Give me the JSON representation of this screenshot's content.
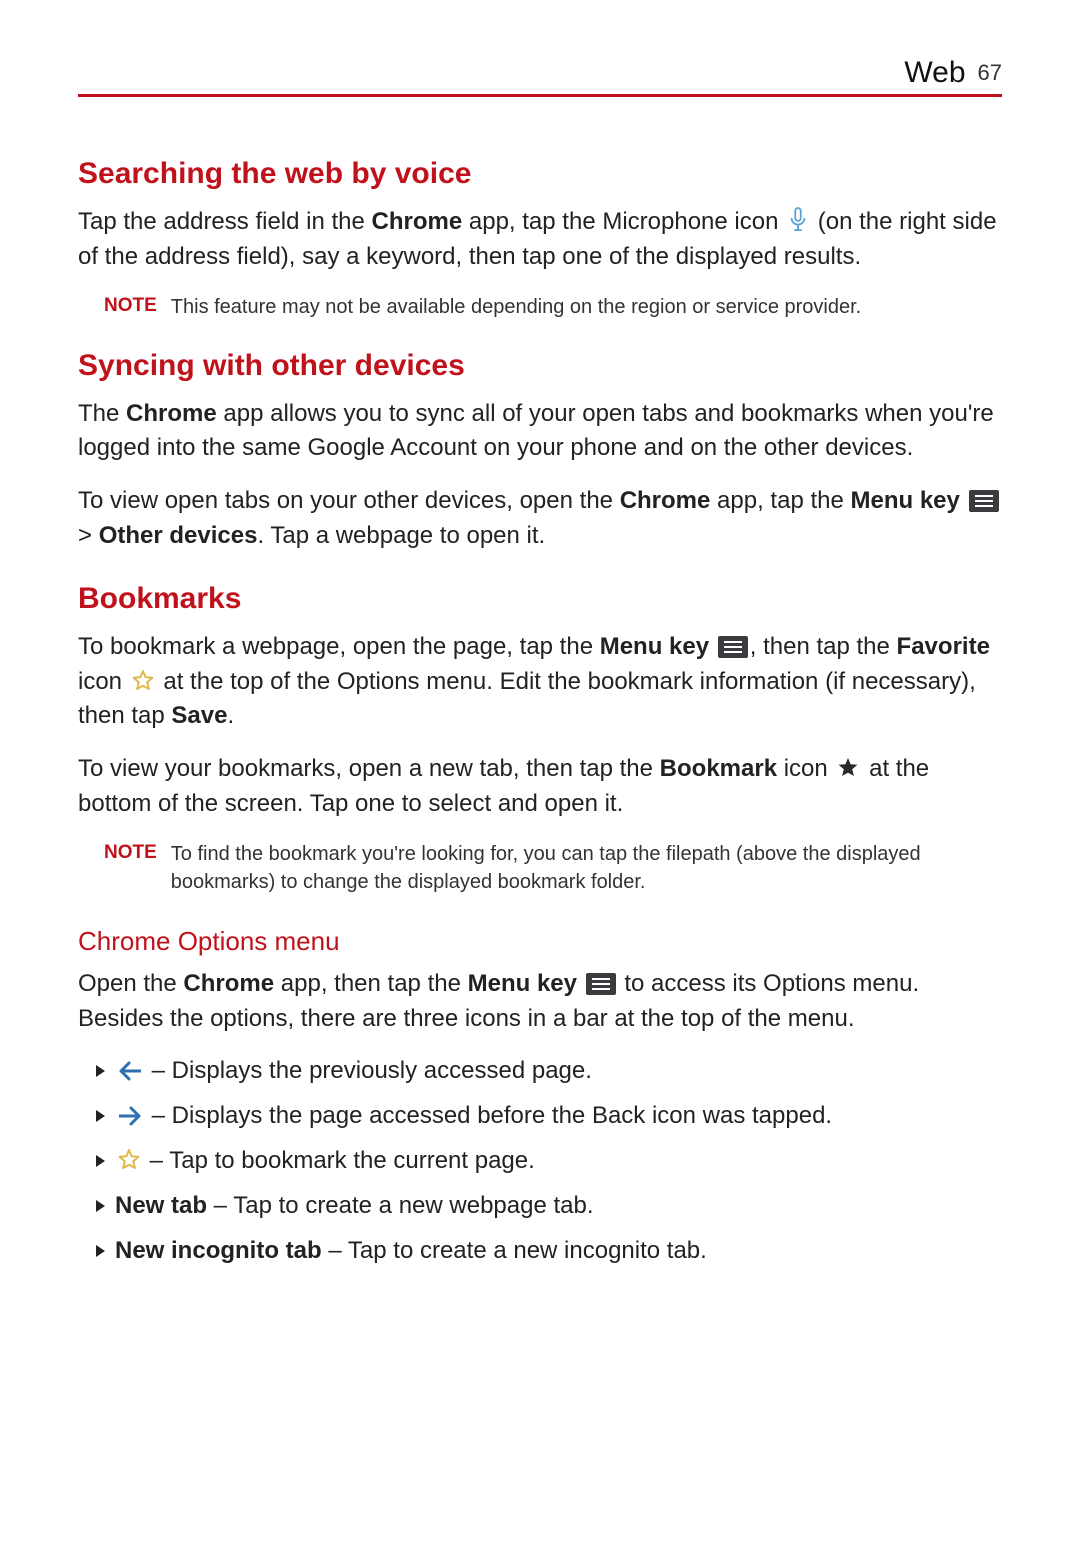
{
  "header": {
    "section": "Web",
    "page_number": "67"
  },
  "s1": {
    "title": "Searching the web by voice",
    "p1a": "Tap the address field in the ",
    "p1_chrome": "Chrome",
    "p1b": " app, tap the Microphone icon ",
    "p1c": " (on the right side of the address field), say a keyword, then tap one of the displayed results.",
    "note_label": "NOTE",
    "note": "This feature may not be available depending on the region or service provider."
  },
  "s2": {
    "title": "Syncing with other devices",
    "p1a": "The ",
    "p1_chrome": "Chrome",
    "p1b": " app allows you to sync all of your open tabs and bookmarks when you're logged into the same Google Account on your phone and on the other devices.",
    "p2a": "To view open tabs on your other devices, open the ",
    "p2_chrome": "Chrome",
    "p2b": " app, tap the ",
    "p2_menukey": "Menu key",
    "p2c": " > ",
    "p2_other": "Other devices",
    "p2d": ". Tap a webpage to open it."
  },
  "s3": {
    "title": "Bookmarks",
    "p1a": "To bookmark a webpage, open the page, tap the ",
    "p1_menukey": "Menu key",
    "p1b": ", then tap the ",
    "p1_fav": "Favorite",
    "p1c": " icon ",
    "p1d": " at the top of the Options menu. Edit the bookmark information (if necessary), then tap ",
    "p1_save": "Save",
    "p1e": ".",
    "p2a": "To view your bookmarks, open a new tab, then tap the ",
    "p2_bm": "Bookmark",
    "p2b": " icon ",
    "p2c": " at the bottom of the screen. Tap one to select and open it.",
    "note_label": "NOTE",
    "note": "To find the bookmark you're looking for, you can tap the filepath (above the displayed bookmarks) to change the displayed bookmark folder."
  },
  "s4": {
    "title": "Chrome Options menu",
    "p1a": "Open the ",
    "p1_chrome": "Chrome",
    "p1b": " app, then tap the ",
    "p1_menukey": "Menu key",
    "p1c": " to access its Options menu. Besides the options, there are three icons in a bar at the top of the menu.",
    "items": [
      {
        "kind": "icon",
        "icon": "back",
        "text": " – Displays the previously accessed page."
      },
      {
        "kind": "icon",
        "icon": "fwd",
        "text": " – Displays the page accessed before the Back icon was tapped."
      },
      {
        "kind": "icon",
        "icon": "star",
        "text": " – Tap to bookmark the current page."
      },
      {
        "kind": "bold",
        "label": "New tab",
        "text": " – Tap to create a new webpage tab."
      },
      {
        "kind": "bold",
        "label": "New incognito tab",
        "text": " – Tap to create a new incognito tab."
      }
    ]
  }
}
